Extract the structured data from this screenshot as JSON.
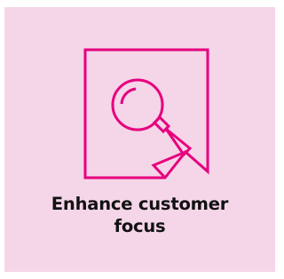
{
  "card": {
    "background": "#f5d5e8",
    "accent": "#e6007e"
  },
  "icon": {
    "name": "magnifying-glass-document-icon"
  },
  "caption": {
    "line1": "Enhance customer",
    "line2": "focus"
  }
}
